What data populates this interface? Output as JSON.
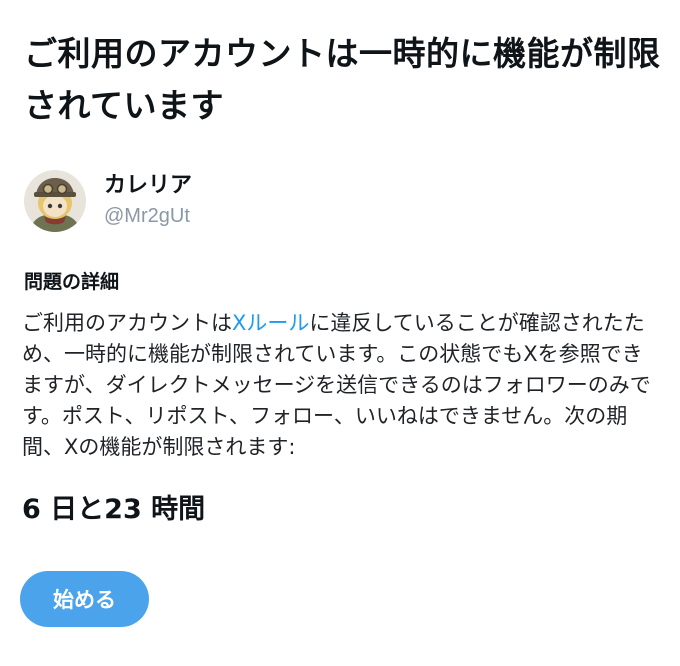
{
  "header": {
    "title": "ご利用のアカウントは一時的に機能が制限されています"
  },
  "account": {
    "display_name": "カレリア",
    "handle": "@Mr2gUt"
  },
  "details": {
    "heading": "問題の詳細",
    "text_before_link": "ご利用のアカウントは",
    "link_text": "Xルール",
    "text_after_link": "に違反していることが確認されたため、一時的に機能が制限されています。この状態でもXを参照できますが、ダイレクトメッセージを送信できるのはフォロワーのみです。ポスト、リポスト、フォロー、いいねはできません。次の期間、Xの機能が制限されます:"
  },
  "duration": {
    "text": "6 日と23 時間"
  },
  "actions": {
    "start_label": "始める"
  },
  "colors": {
    "link": "#1d9bf0",
    "button": "#4ba3ec",
    "handle": "#8b98a5"
  }
}
